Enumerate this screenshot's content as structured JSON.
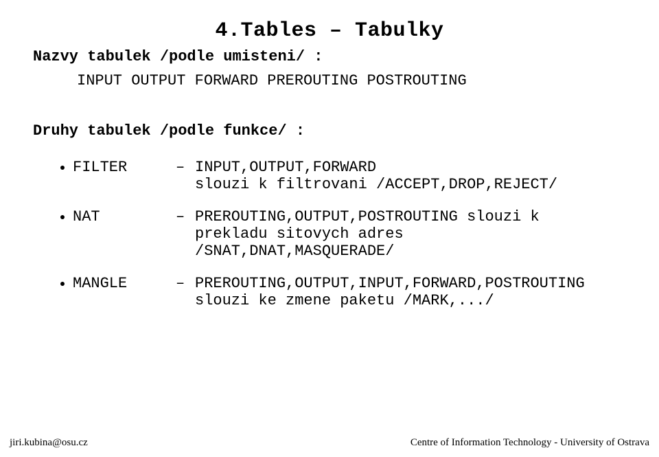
{
  "title": "4.Tables – Tabulky",
  "section1": {
    "label": "Nazvy tabulek /podle umisteni/ :",
    "value": "INPUT OUTPUT FORWARD PREROUTING POSTROUTING"
  },
  "section2": {
    "label": "Druhy tabulek /podle funkce/ :",
    "items": [
      {
        "name": "FILTER",
        "dash": "–",
        "lines": [
          "INPUT,OUTPUT,FORWARD",
          "slouzi k filtrovani /ACCEPT,DROP,REJECT/"
        ]
      },
      {
        "name": "NAT",
        "dash": "–",
        "lines": [
          "PREROUTING,OUTPUT,POSTROUTING slouzi k",
          "prekladu sitovych adres",
          "/SNAT,DNAT,MASQUERADE/"
        ]
      },
      {
        "name": "MANGLE",
        "dash": "–",
        "lines": [
          "PREROUTING,OUTPUT,INPUT,FORWARD,POSTROUTING",
          "slouzi ke zmene paketu /MARK,.../"
        ]
      }
    ]
  },
  "footer": {
    "left": "jiri.kubina@osu.cz",
    "right": "Centre of Information Technology - University of Ostrava"
  }
}
